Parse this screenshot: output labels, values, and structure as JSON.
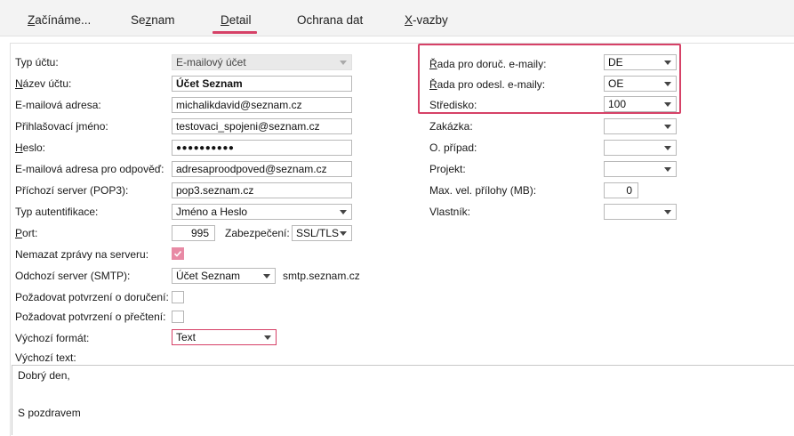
{
  "tabs": [
    {
      "label_pre": "",
      "accel": "Z",
      "label_post": "ačínáme..."
    },
    {
      "label_pre": "Se",
      "accel": "z",
      "label_post": "nam"
    },
    {
      "label_pre": "",
      "accel": "D",
      "label_post": "etail"
    },
    {
      "label_pre": "Ochrana dat",
      "accel": "",
      "label_post": ""
    },
    {
      "label_pre": "",
      "accel": "X",
      "label_post": "-vazby"
    }
  ],
  "left": {
    "typ_uctu": {
      "label": "Typ účtu:",
      "value": "E-mailový účet"
    },
    "nazev_uctu": {
      "label_pre": "",
      "accel": "N",
      "label_post": "ázev účtu:",
      "value": "Účet Seznam"
    },
    "email": {
      "label": "E-mailová adresa:",
      "value": "michalikdavid@seznam.cz"
    },
    "login": {
      "label_pre": "Přihlašovací ",
      "accel": "j",
      "label_post": "méno:",
      "value": "testovaci_spojeni@seznam.cz"
    },
    "heslo": {
      "label_pre": "",
      "accel": "H",
      "label_post": "eslo:",
      "value": "●●●●●●●●●●"
    },
    "reply": {
      "label": "E-mailová adresa pro odpověď:",
      "value": "adresaproodpoved@seznam.cz"
    },
    "pop3": {
      "label": "Příchozí server (POP3):",
      "value": "pop3.seznam.cz"
    },
    "auth": {
      "label": "Typ autentifikace:",
      "value": "Jméno a Heslo"
    },
    "port": {
      "label_pre": "",
      "accel": "P",
      "label_post": "ort:",
      "value": "995",
      "security_label": "Zabezpečení:",
      "security_value": "SSL/TLS"
    },
    "nemazat": {
      "label": "Nemazat zprávy na serveru:",
      "checked": true
    },
    "smtp": {
      "label": "Odchozí server (SMTP):",
      "value": "Účet Seznam",
      "server_text": "smtp.seznam.cz"
    },
    "potvrzeni_doruceni": {
      "label": "Požadovat potvrzení o doručení:",
      "checked": false
    },
    "potvrzeni_precteni": {
      "label": "Požadovat potvrzení o přečtení:",
      "checked": false
    },
    "format": {
      "label": "Výchozí formát:",
      "value": "Text"
    },
    "text": {
      "label": "Výchozí text:",
      "lines": [
        "Dobrý den,",
        "",
        "",
        "S pozdravem"
      ]
    }
  },
  "right": {
    "rada_doruc": {
      "label_pre": "",
      "accel": "Ř",
      "label_post": "ada pro doruč. e-maily:",
      "value": "DE"
    },
    "rada_odesl": {
      "label_pre": "",
      "accel": "Ř",
      "label_post": "ada pro odesl. e-maily:",
      "value": "OE"
    },
    "stredisko": {
      "label": "Středisko:",
      "value": "100"
    },
    "zakazka": {
      "label": "Zakázka:",
      "value": ""
    },
    "pripad": {
      "label": "O. případ:",
      "value": ""
    },
    "projekt": {
      "label": "Projekt:",
      "value": ""
    },
    "max_priloha": {
      "label": "Max. vel. přílohy (MB):",
      "value": "0"
    },
    "vlastnik": {
      "label": "Vlastník:",
      "value": ""
    }
  },
  "colors": {
    "accent": "#d64167",
    "checkbox_checked": "#e88aa5"
  }
}
